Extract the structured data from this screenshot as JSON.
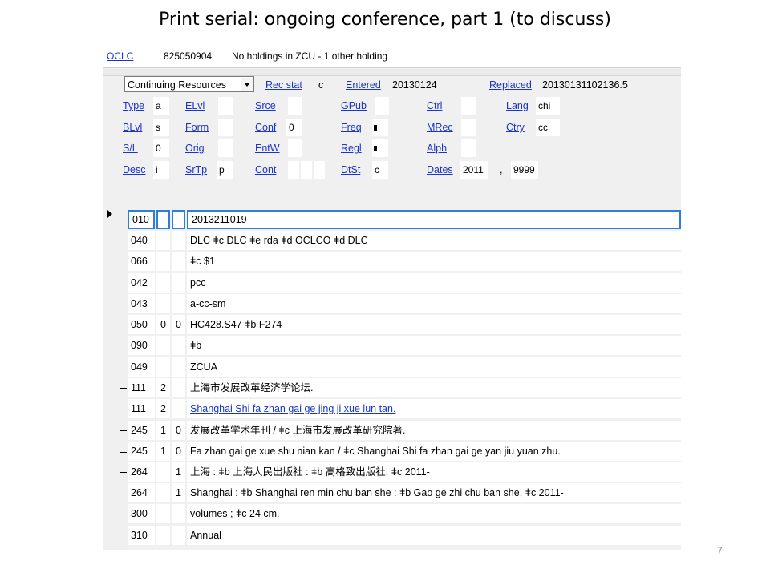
{
  "slide": {
    "title": "Print serial: ongoing conference, part 1 (to discuss)",
    "page_number": "7"
  },
  "record_header": {
    "oclc_label": "OCLC",
    "oclc_number": "825050904",
    "holdings_text": "No holdings in ZCU - 1 other holding"
  },
  "fixed_fields": {
    "format_select": "Continuing Resources",
    "rec_stat_label": "Rec stat",
    "rec_stat_value": "c",
    "entered_label": "Entered",
    "entered_value": "20130124",
    "replaced_label": "Replaced",
    "replaced_value": "20130131102136.5",
    "type_label": "Type",
    "type_value": "a",
    "elvl_label": "ELvl",
    "elvl_value": "",
    "srce_label": "Srce",
    "srce_value": "",
    "gpub_label": "GPub",
    "gpub_value": "",
    "ctrl_label": "Ctrl",
    "ctrl_value": "",
    "lang_label": "Lang",
    "lang_value": "chi",
    "blvl_label": "BLvl",
    "blvl_value": "s",
    "form_label": "Form",
    "form_value": "",
    "conf_label": "Conf",
    "conf_value": "0",
    "freq_label": "Freq",
    "mrec_label": "MRec",
    "mrec_value": "",
    "ctry_label": "Ctry",
    "ctry_value": "cc",
    "sl_label": "S/L",
    "sl_value": "0",
    "orig_label": "Orig",
    "orig_value": "",
    "entw_label": "EntW",
    "entw_value": "",
    "regl_label": "Regl",
    "alph_label": "Alph",
    "alph_value": "",
    "desc_label": "Desc",
    "desc_value": "i",
    "srtp_label": "SrTp",
    "srtp_value": "p",
    "cont_label": "Cont",
    "dtst_label": "DtSt",
    "dtst_value": "c",
    "dates_label": "Dates",
    "dates_value1": "2011",
    "dates_sep": ",",
    "dates_value2": "9999"
  },
  "variable_fields": [
    {
      "tag": "010",
      "ind1": "",
      "ind2": "",
      "data": "2013211019"
    },
    {
      "tag": "040",
      "ind1": "",
      "ind2": "",
      "data": "DLC ǂc DLC ǂe rda ǂd OCLCO ǂd DLC"
    },
    {
      "tag": "066",
      "ind1": "",
      "ind2": "",
      "data": "ǂc $1"
    },
    {
      "tag": "042",
      "ind1": "",
      "ind2": "",
      "data": "pcc"
    },
    {
      "tag": "043",
      "ind1": "",
      "ind2": "",
      "data": "a-cc-sm"
    },
    {
      "tag": "050",
      "ind1": "0",
      "ind2": "0",
      "data": "HC428.S47 ǂb F274"
    },
    {
      "tag": "090",
      "ind1": "",
      "ind2": "",
      "data": "ǂb"
    },
    {
      "tag": "049",
      "ind1": "",
      "ind2": "",
      "data": "ZCUA"
    },
    {
      "tag": "111",
      "ind1": "2",
      "ind2": "",
      "data": "上海市发展改革经济学论坛."
    },
    {
      "tag": "111",
      "ind1": "2",
      "ind2": "",
      "data": "Shanghai Shi fa zhan gai ge jing ji xue lun tan."
    },
    {
      "tag": "245",
      "ind1": "1",
      "ind2": "0",
      "data": "发展改革学术年刊 / ǂc 上海市发展改革研究院著."
    },
    {
      "tag": "245",
      "ind1": "1",
      "ind2": "0",
      "data": "Fa zhan gai ge xue shu nian kan / ǂc Shanghai Shi fa zhan gai ge yan jiu yuan zhu."
    },
    {
      "tag": "264",
      "ind1": "",
      "ind2": "1",
      "data": "上海 : ǂb 上海人民出版社 : ǂb 高格致出版社, ǂc 2011-"
    },
    {
      "tag": "264",
      "ind1": "",
      "ind2": "1",
      "data": "Shanghai : ǂb Shanghai ren min chu ban she : ǂb Gao ge zhi chu ban she, ǂc 2011-"
    },
    {
      "tag": "300",
      "ind1": "",
      "ind2": "",
      "data": "volumes ; ǂc 24 cm."
    },
    {
      "tag": "310",
      "ind1": "",
      "ind2": "",
      "data": "Annual"
    }
  ]
}
